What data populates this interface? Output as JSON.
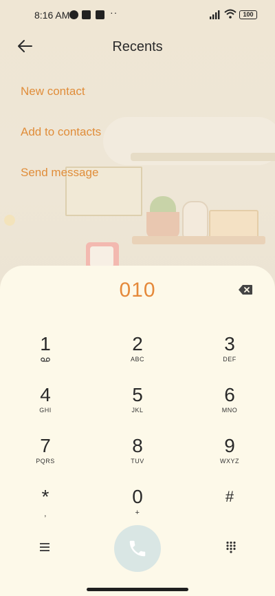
{
  "status_bar": {
    "time": "8:16 AM",
    "battery": "100"
  },
  "header": {
    "title": "Recents"
  },
  "actions": [
    {
      "label": "New contact"
    },
    {
      "label": "Add to contacts"
    },
    {
      "label": "Send message"
    }
  ],
  "dialer": {
    "number": "010",
    "keys": [
      {
        "digit": "1",
        "letters": ""
      },
      {
        "digit": "2",
        "letters": "ABC"
      },
      {
        "digit": "3",
        "letters": "DEF"
      },
      {
        "digit": "4",
        "letters": "GHI"
      },
      {
        "digit": "5",
        "letters": "JKL"
      },
      {
        "digit": "6",
        "letters": "MNO"
      },
      {
        "digit": "7",
        "letters": "PQRS"
      },
      {
        "digit": "8",
        "letters": "TUV"
      },
      {
        "digit": "9",
        "letters": "WXYZ"
      },
      {
        "digit": "*",
        "letters": ","
      },
      {
        "digit": "0",
        "letters": "+"
      },
      {
        "digit": "#",
        "letters": ""
      }
    ]
  },
  "colors": {
    "accent": "#e08d3a",
    "pad_background": "#fdf9e9",
    "call_button": "#d9e6e4"
  },
  "icons": {
    "back": "arrow-left-icon",
    "backspace": "backspace-icon",
    "voicemail": "voicemail-icon",
    "menu": "menu-icon",
    "call": "phone-icon",
    "dialpad": "dialpad-icon"
  }
}
